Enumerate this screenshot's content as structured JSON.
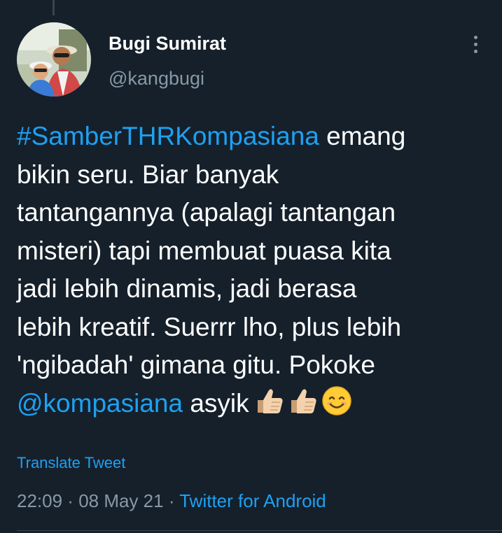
{
  "author": {
    "display_name": "Bugi Sumirat",
    "handle": "@kangbugi"
  },
  "tweet": {
    "hashtag": "#SamberTHRKompasiana",
    "line1_rest": " emang",
    "line2": "bikin seru. Biar banyak",
    "line3": "tantangannya (apalagi tantangan",
    "line4": "misteri) tapi membuat puasa kita",
    "line5": "jadi lebih dinamis, jadi berasa",
    "line6": "lebih kreatif. Suerrr lho, plus lebih",
    "line7": "'ngibadah' gimana gitu. Pokoke",
    "mention": "@kompasiana",
    "line8_rest": " asyik",
    "emojis": [
      "thumbs-up-icon",
      "thumbs-up-icon",
      "smiling-face-icon"
    ]
  },
  "translate_label": "Translate Tweet",
  "meta": {
    "time": "22:09",
    "separator": " · ",
    "date": "08 May 21",
    "separator2": " · ",
    "source": "Twitter for Android"
  },
  "colors": {
    "background": "#15202b",
    "link": "#1da1f2",
    "secondary_text": "#8899a6",
    "primary_text": "#ffffff"
  }
}
